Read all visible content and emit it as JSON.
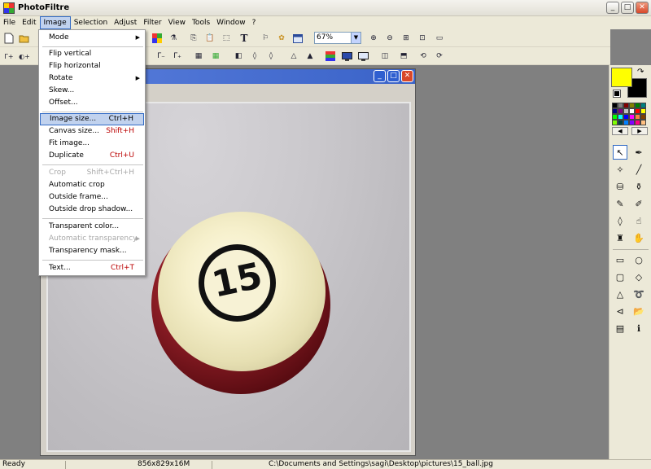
{
  "app": {
    "title": "PhotoFiltre"
  },
  "window_buttons": {
    "minimize": "_",
    "maximize": "□",
    "close": "✕"
  },
  "menubar": [
    "File",
    "Edit",
    "Image",
    "Selection",
    "Adjust",
    "Filter",
    "View",
    "Tools",
    "Window",
    "?"
  ],
  "toolbar": {
    "zoom_value": "67%",
    "zoom_dropdown": "▼"
  },
  "image_menu": {
    "items": [
      {
        "label": "Mode",
        "submenu": true
      },
      {
        "label": "Flip vertical"
      },
      {
        "label": "Flip horizontal"
      },
      {
        "label": "Rotate",
        "submenu": true
      },
      {
        "label": "Skew..."
      },
      {
        "label": "Offset..."
      },
      {
        "label": "Image size...",
        "shortcut": "Ctrl+H",
        "highlighted": true
      },
      {
        "label": "Canvas size...",
        "shortcut": "Shift+H"
      },
      {
        "label": "Fit image..."
      },
      {
        "label": "Duplicate",
        "shortcut": "Ctrl+U"
      },
      {
        "label": "Crop",
        "shortcut": "Shift+Ctrl+H",
        "disabled": true
      },
      {
        "label": "Automatic crop"
      },
      {
        "label": "Outside frame..."
      },
      {
        "label": "Outside drop shadow..."
      },
      {
        "label": "Transparent color..."
      },
      {
        "label": "Automatic transparency",
        "submenu": true,
        "disabled": true
      },
      {
        "label": "Transparency mask..."
      },
      {
        "label": "Text...",
        "shortcut": "Ctrl+T"
      }
    ]
  },
  "image": {
    "ball_number": "15"
  },
  "colors": {
    "foreground": "#ffff00",
    "background": "#000000"
  },
  "status": {
    "state": "Ready",
    "dimensions": "856x829x16M",
    "path": "C:\\Documents and Settings\\sagi\\Desktop\\pictures\\15_ball.jpg"
  }
}
